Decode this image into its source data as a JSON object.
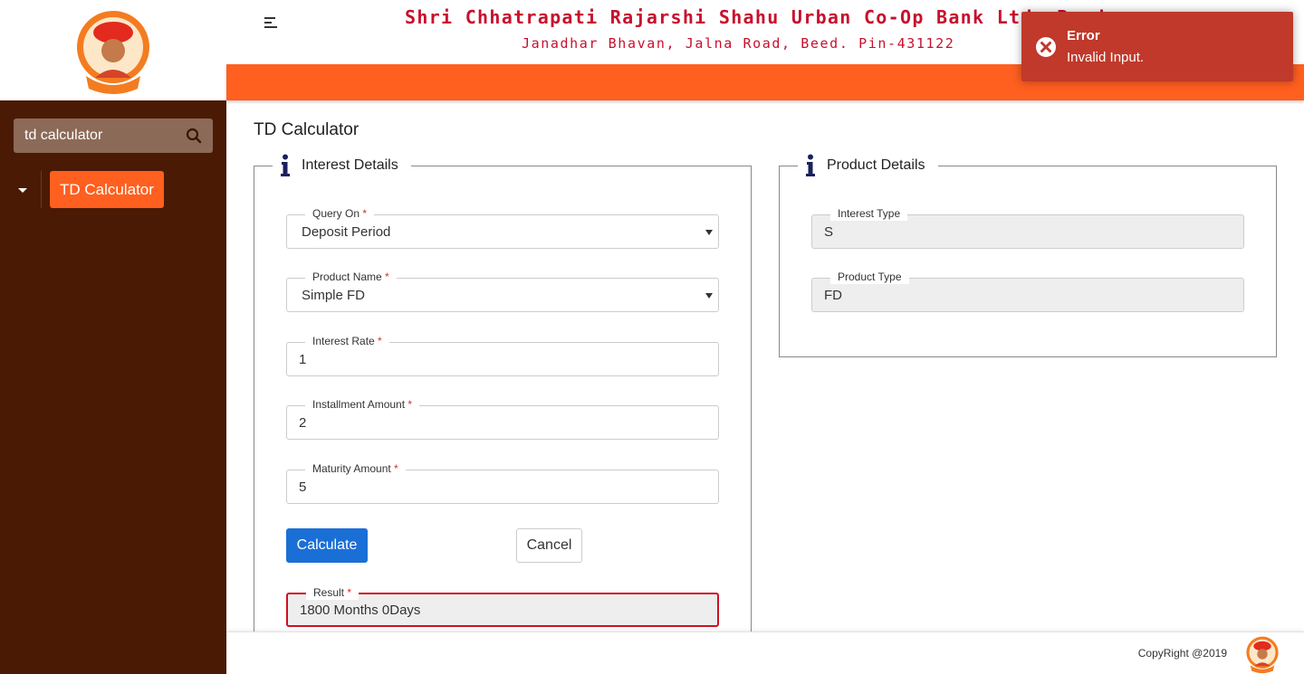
{
  "sidebar": {
    "search": {
      "value": "td calculator",
      "placeholder": "Search"
    },
    "menu": [
      {
        "label": "TD Calculator"
      }
    ]
  },
  "header": {
    "bank_name": "Shri Chhatrapati Rajarshi Shahu Urban Co-Op Bank Ltd. Beed",
    "address": "Janadhar Bhavan, Jalna Road, Beed. Pin-431122"
  },
  "page": {
    "title": "TD Calculator"
  },
  "interest_details": {
    "legend": "Interest Details",
    "query_on": {
      "label": "Query On",
      "value": "Deposit Period"
    },
    "product_name": {
      "label": "Product Name",
      "value": "Simple FD"
    },
    "interest_rate": {
      "label": "Interest Rate",
      "value": "1"
    },
    "installment_amount": {
      "label": "Installment Amount",
      "value": "2"
    },
    "maturity_amount": {
      "label": "Maturity Amount",
      "value": "5"
    },
    "calculate_label": "Calculate",
    "cancel_label": "Cancel",
    "result": {
      "label": "Result",
      "value": "1800 Months 0Days"
    }
  },
  "product_details": {
    "legend": "Product Details",
    "interest_type": {
      "label": "Interest Type",
      "value": "S"
    },
    "product_type": {
      "label": "Product Type",
      "value": "FD"
    }
  },
  "footer": {
    "copyright": "CopyRight @2019"
  },
  "toast": {
    "title": "Error",
    "message": "Invalid Input."
  },
  "colors": {
    "sidebar_bg": "#4a1a04",
    "accent_orange": "#ff5f1f",
    "bank_red": "#c8102e",
    "primary_blue": "#1a6fd6",
    "error_red": "#c0392b"
  },
  "icons": [
    "search-icon",
    "caret-down-icon",
    "hamburger-icon",
    "info-icon",
    "chevron-down-icon",
    "error-icon",
    "bank-logo"
  ]
}
